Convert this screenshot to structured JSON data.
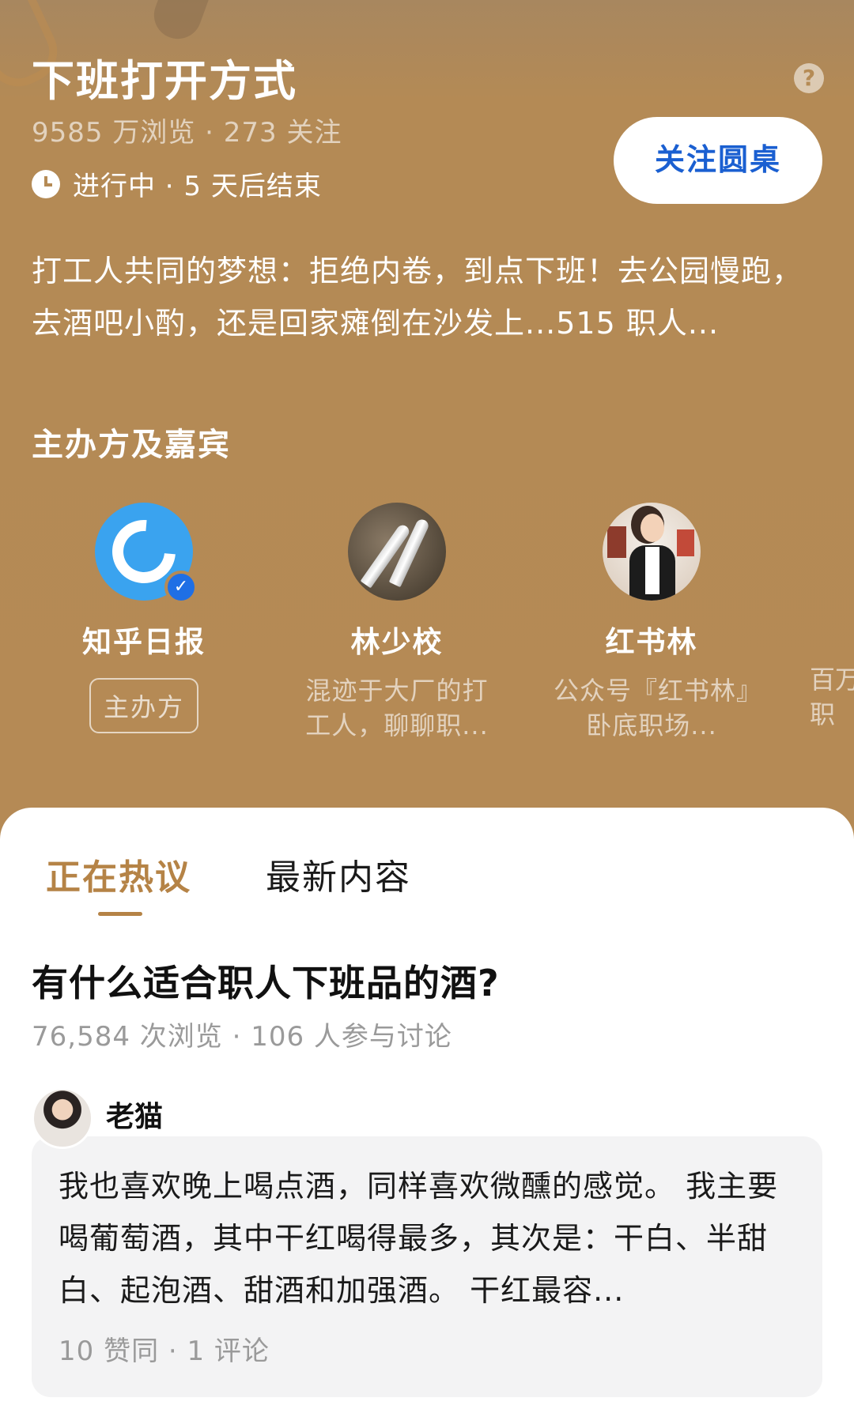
{
  "header": {
    "title": "下班打开方式",
    "stats": "9585 万浏览 · 273 关注",
    "status": "进行中 · 5 天后结束",
    "follow_label": "关注圆桌",
    "help": "?"
  },
  "description": "打工人共同的梦想：拒绝内卷，到点下班！去公园慢跑，去酒吧小酌，还是回家瘫倒在沙发上...515 职人...",
  "guests_section": {
    "title": "主办方及嘉宾",
    "guests": [
      {
        "name": "知乎日报",
        "badge": "主办方",
        "icon": "zhihu-daily-avatar"
      },
      {
        "name": "林少校",
        "bio": "混迹于大厂的打工人，聊聊职...",
        "icon": "knives-avatar"
      },
      {
        "name": "红书林",
        "bio": "公众号『红书林』卧底职场...",
        "icon": "businesswoman-avatar"
      }
    ],
    "partial_bio": "百万\n职"
  },
  "tabs": [
    {
      "label": "正在热议",
      "active": true
    },
    {
      "label": "最新内容",
      "active": false
    }
  ],
  "question": {
    "title": "有什么适合职人下班品的酒?",
    "stats": "76,584 次浏览 · 106 人参与讨论"
  },
  "answer": {
    "author": "老猫",
    "text": "我也喜欢晚上喝点酒，同样喜欢微醺的感觉。 我主要喝葡萄酒，其中干红喝得最多，其次是：干白、半甜白、起泡酒、甜酒和加强酒。 干红最容...",
    "meta": "10 赞同 · 1 评论"
  },
  "colors": {
    "hero_bg": "#b58a55",
    "accent_tab": "#b58346",
    "follow_text": "#1a5fd1",
    "verified": "#1f6fe5"
  }
}
